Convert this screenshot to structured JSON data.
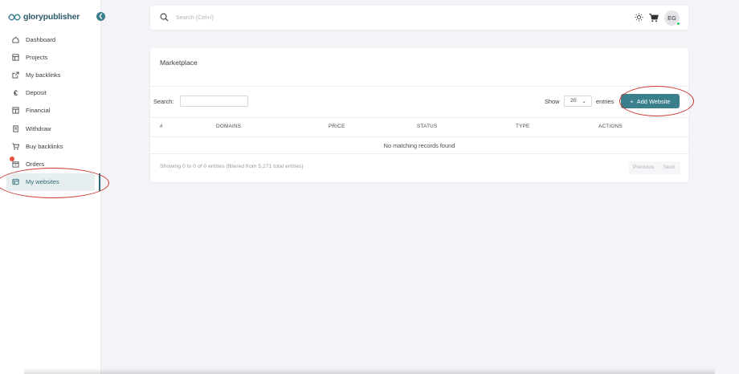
{
  "brand": {
    "name": "glorypublisher",
    "collapse_icon": "chevron-left-icon",
    "accent": "#3a7f8c"
  },
  "sidebar": {
    "items": [
      {
        "label": "Dashboard",
        "icon": "home-icon"
      },
      {
        "label": "Projects",
        "icon": "projects-icon"
      },
      {
        "label": "My backlinks",
        "icon": "external-link-icon"
      },
      {
        "label": "Deposit",
        "icon": "euro-icon"
      },
      {
        "label": "Financial",
        "icon": "layout-icon"
      },
      {
        "label": "Withdraw",
        "icon": "receipt-icon"
      },
      {
        "label": "Buy backlinks",
        "icon": "cart-icon"
      },
      {
        "label": "Orders",
        "icon": "box-icon"
      },
      {
        "label": "My websites",
        "icon": "websites-icon",
        "active": true
      }
    ],
    "orders_badge": ""
  },
  "topbar": {
    "search_placeholder": "Search (Ctrl+/)",
    "avatar_initials": "EG",
    "status_color": "#28c76f"
  },
  "marketplace": {
    "title": "Marketplace",
    "search_label": "Search:",
    "show_label": "Show",
    "entries_value": "20",
    "entries_label": "entries",
    "add_button": "Add Website",
    "columns": [
      "#",
      "DOMAINS",
      "PRICE",
      "STATUS",
      "TYPE",
      "ACTIONS"
    ],
    "empty_message": "No matching records found",
    "info": "Showing 0 to 0 of 0 entries (filtered from 5,271 total entries)",
    "prev_label": "Previous",
    "next_label": "Next"
  }
}
